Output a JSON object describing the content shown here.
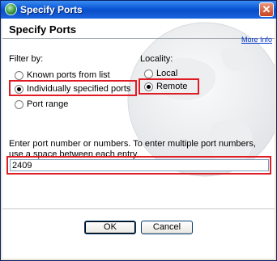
{
  "window": {
    "title": "Specify Ports",
    "close_glyph": "✕"
  },
  "header": {
    "title": "Specify Ports",
    "more_info": "More Info"
  },
  "filter": {
    "label": "Filter by:",
    "options": [
      {
        "label": "Known ports from list",
        "checked": false
      },
      {
        "label": "Individually specified ports",
        "checked": true
      },
      {
        "label": "Port range",
        "checked": false
      }
    ]
  },
  "locality": {
    "label": "Locality:",
    "options": [
      {
        "label": "Local",
        "checked": false
      },
      {
        "label": "Remote",
        "checked": true
      }
    ]
  },
  "port_entry": {
    "instructions": "Enter port number or numbers. To enter multiple port numbers, use a space between each entry.",
    "value": "2409"
  },
  "buttons": {
    "ok": "OK",
    "cancel": "Cancel"
  },
  "colors": {
    "highlight": "#e01c24",
    "titlebar": "#0b56d6",
    "link": "#0033cc"
  }
}
